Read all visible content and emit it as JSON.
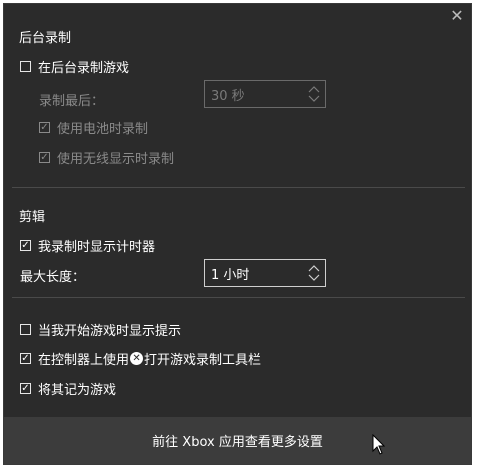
{
  "sections": {
    "background": {
      "title": "后台录制",
      "record_in_background": {
        "label": "在后台录制游戏",
        "checked": false
      },
      "record_last_label": "录制最后：",
      "record_last_value": "30 秒",
      "battery": {
        "label": "使用电池时录制",
        "checked": true
      },
      "wireless": {
        "label": "使用无线显示时录制",
        "checked": true
      }
    },
    "clip": {
      "title": "剪辑",
      "show_timer": {
        "label": "我录制时显示计时器",
        "checked": true
      },
      "max_length_label": "最大长度：",
      "max_length_value": "1 小时"
    },
    "other": {
      "show_tips": {
        "label": "当我开始游戏时显示提示",
        "checked": false
      },
      "controller_prefix": "在控制器上使用",
      "controller_suffix": "打开游戏录制工具栏",
      "controller_checked": true,
      "mark_as_game": {
        "label": "将其记为游戏",
        "checked": true
      }
    }
  },
  "footer": {
    "label": "前往 Xbox 应用查看更多设置"
  },
  "icons": {
    "close": "close-icon",
    "xbox": "xbox-icon",
    "checkbox": "checkbox-icon",
    "spinner": "spinner-icon",
    "cursor": "mouse-pointer-icon"
  }
}
